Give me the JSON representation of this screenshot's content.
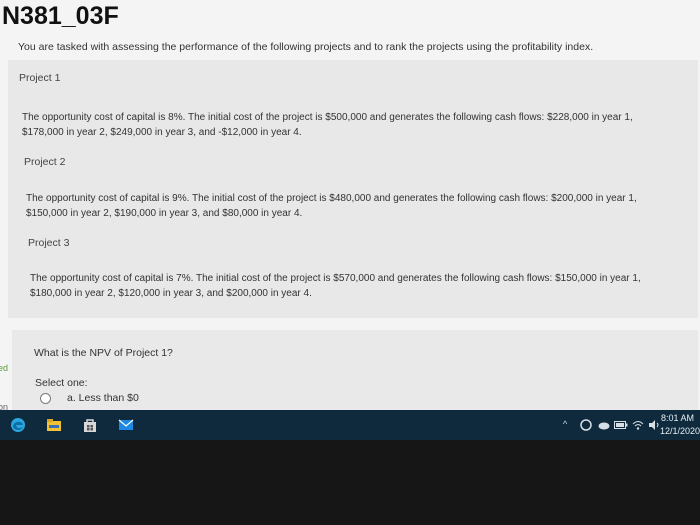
{
  "header": {
    "course_code": "N381_03F"
  },
  "intro": "You are tasked with assessing the performance of the following projects and to rank the projects using the profitability index.",
  "projects": [
    {
      "label": "Project 1",
      "line1": "The opportunity cost of capital is 8%.  The initial cost of the project is $500,000 and generates the following cash flows: $228,000 in year 1,",
      "line2": "$178,000 in year 2, $249,000 in year 3, and -$12,000 in year 4."
    },
    {
      "label": "Project 2",
      "line1": "The opportunity cost of capital is 9%.  The initial cost of the project is $480,000 and generates the following cash flows: $200,000 in year 1,",
      "line2": "$150,000 in year 2, $190,000 in year 3, and $80,000 in year 4."
    },
    {
      "label": "Project 3",
      "line1": "The opportunity cost of capital is 7%.  The initial cost of the project is $570,000 and generates the following cash flows: $150,000 in year 1,",
      "line2": "$180,000 in year 2, $120,000 in year 3, and $200,000 in year 4."
    }
  ],
  "question": {
    "text": "What is the NPV of Project 1?",
    "select_label": "Select one:",
    "options": [
      {
        "label": "a. Less than $0"
      }
    ]
  },
  "sidebar": {
    "fragment_1": "ed",
    "fragment_2": "on"
  },
  "taskbar": {
    "time": "8:01 AM",
    "date": "12/1/2020"
  },
  "colors": {
    "taskbar": "#0f2a3d",
    "edge": "#2aa6df",
    "explorer": "#f1c232",
    "mail": "#1e88e5"
  },
  "icons": [
    "edge-icon",
    "file-explorer-icon",
    "store-icon",
    "mail-icon",
    "chevron-up-icon",
    "onedrive-icon",
    "battery-icon",
    "wifi-icon",
    "volume-icon"
  ]
}
